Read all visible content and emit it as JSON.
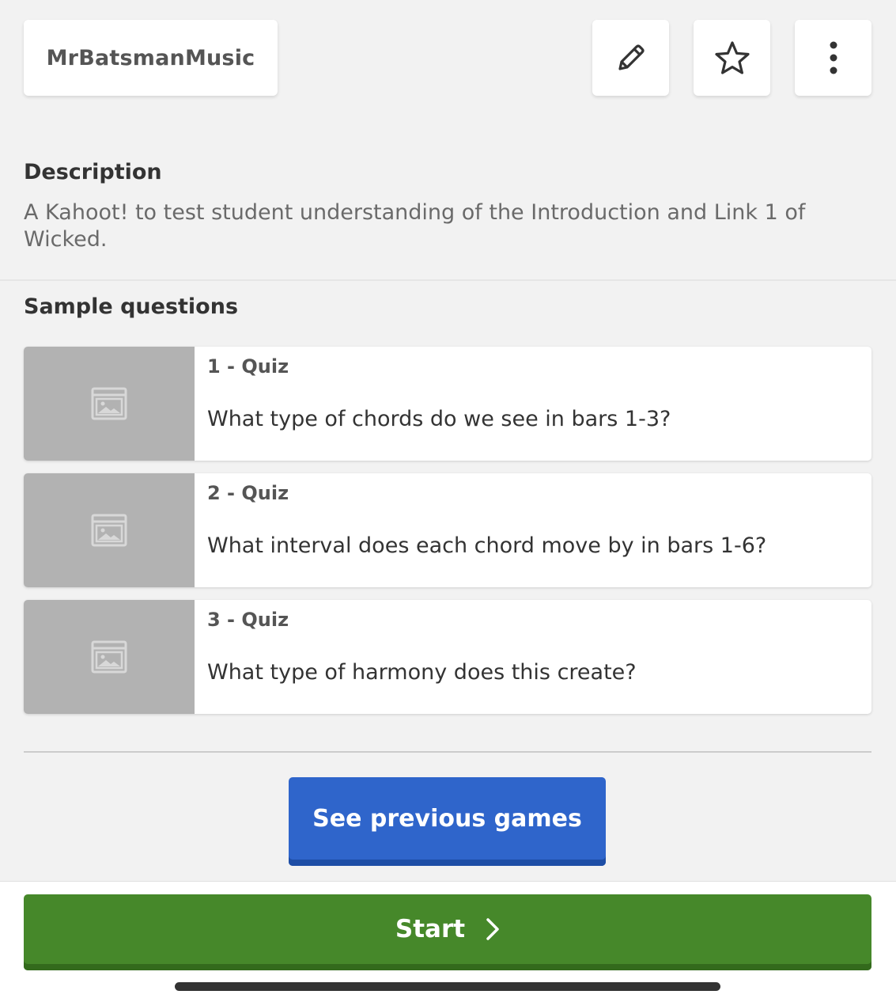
{
  "header": {
    "author": "MrBatsmanMusic",
    "icons": {
      "edit": "pencil-icon",
      "favorite": "star-icon",
      "more": "more-vertical-icon"
    }
  },
  "description": {
    "title": "Description",
    "text": "A Kahoot! to test student understanding of the Introduction and Link 1 of Wicked."
  },
  "sample_questions": {
    "title": "Sample questions",
    "items": [
      {
        "type": "1 - Quiz",
        "text": "What type of chords do we see in bars 1-3?",
        "icon": "image-placeholder-icon"
      },
      {
        "type": "2 - Quiz",
        "text": "What interval does each chord move by in bars 1-6?",
        "icon": "image-placeholder-icon"
      },
      {
        "type": "3 - Quiz",
        "text": "What type of harmony does this create?",
        "icon": "image-placeholder-icon"
      }
    ]
  },
  "actions": {
    "previous_games_label": "See previous games",
    "start_label": "Start",
    "start_icon": "chevron-right-icon"
  },
  "colors": {
    "background": "#f2f2f2",
    "primary_blue": "#2f65cb",
    "start_green": "#46882a",
    "thumb_gray": "#b2b2b2"
  }
}
